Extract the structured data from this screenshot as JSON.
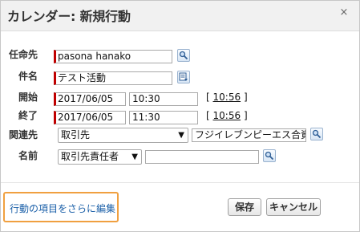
{
  "dialog": {
    "title": "カレンダー: 新規行動",
    "close_symbol": "×"
  },
  "fields": {
    "assigned": {
      "label": "任命先",
      "value": "pasona hanako",
      "icon": "lookup-icon"
    },
    "subject": {
      "label": "件名",
      "value": "テスト活動",
      "icon": "combo-list-icon"
    },
    "start": {
      "label": "開始",
      "date": "2017/06/05",
      "time": "10:30",
      "link": "10:56",
      "bracket_open": "[",
      "bracket_close": "]"
    },
    "end": {
      "label": "終了",
      "date": "2017/06/05",
      "time": "11:30",
      "link": "10:56",
      "bracket_open": "[",
      "bracket_close": "]"
    },
    "related": {
      "label": "関連先",
      "type_selected": "取引先",
      "value": "フジイレブンピーエス合資会",
      "icon": "lookup-icon"
    },
    "name": {
      "label": "名前",
      "type_selected": "取引先責任者",
      "value": "",
      "icon": "lookup-icon"
    }
  },
  "footer": {
    "more_link": "行動の項目をさらに編集",
    "save_button": "保存",
    "cancel_button": "キャンセル"
  },
  "colors": {
    "required_marker": "#c00000",
    "link": "#1a5fa8",
    "highlight_box": "#f0a040"
  }
}
